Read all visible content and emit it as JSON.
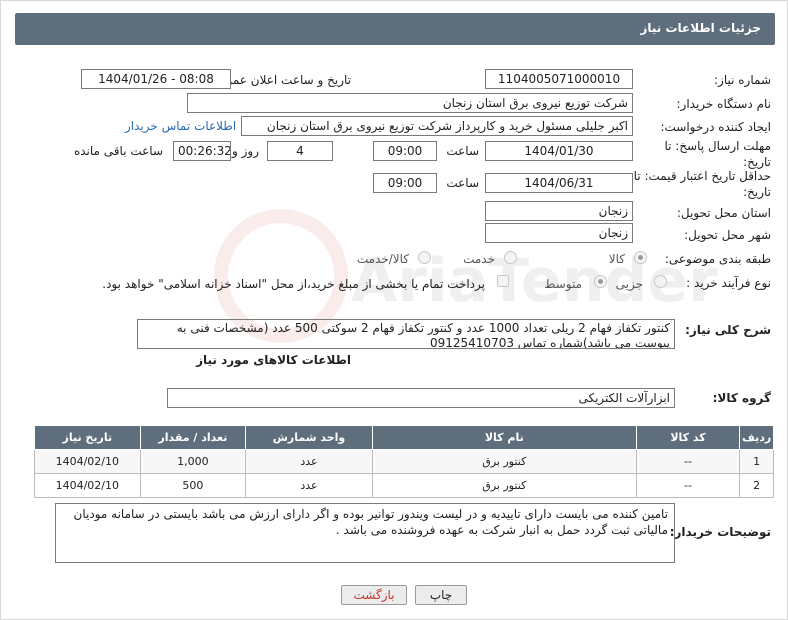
{
  "header": {
    "title": "جزئیات اطلاعات نیاز"
  },
  "fields": {
    "need_number_label": "شماره نیاز:",
    "need_number": "1104005071000010",
    "announce_datetime_label": "تاریخ و ساعت اعلان عمومی:",
    "announce_datetime": "1404/01/26 - 08:08",
    "buyer_org_label": "نام دستگاه خریدار:",
    "buyer_org": "شرکت توزیع نیروی برق استان زنجان",
    "requester_label": "ایجاد کننده درخواست:",
    "requester": "اکبر جلیلی مسئول خرید و کارپرداز شرکت توزیع نیروی برق استان زنجان",
    "buyer_contact_link": "اطلاعات تماس خریدار",
    "deadline_label": "مهلت ارسال پاسخ: تا تاریخ:",
    "deadline_date": "1404/01/30",
    "time_label": "ساعت",
    "deadline_time": "09:00",
    "days_value": "4",
    "days_label": "روز و",
    "remaining_time": "00:26:32",
    "remaining_label": "ساعت باقی مانده",
    "validity_label": "حداقل تاریخ اعتبار قیمت: تا تاریخ:",
    "validity_date": "1404/06/31",
    "validity_time": "09:00",
    "province_label": "استان محل تحویل:",
    "province": "زنجان",
    "city_label": "شهر محل تحویل:",
    "city": "زنجان",
    "category_label": "طبقه بندی موضوعی:",
    "category_options": [
      "کالا",
      "خدمت",
      "کالا/خدمت"
    ],
    "purchase_type_label": "نوع فرآیند خرید :",
    "purchase_options": [
      "جزیی",
      "متوسط"
    ],
    "purchase_note": "پرداخت تمام یا بخشی از مبلغ خرید،از محل \"اسناد خزانه اسلامی\" خواهد بود."
  },
  "description": {
    "label": "شرح کلی نیاز:",
    "text": "کنتور تکفاز فهام 2 ریلی تعداد 1000 عدد و کنتور تکفاز فهام 2 سوکتی 500 عدد (مشخصات فنی به پیوست می باشد)شماره تماس 09125410703"
  },
  "goods_info_title": "اطلاعات کالاهای مورد نیاز",
  "goods_group": {
    "label": "گروه کالا:",
    "value": "ابزارآلات الکتریکی"
  },
  "table": {
    "headers": [
      "ردیف",
      "کد کالا",
      "نام کالا",
      "واحد شمارش",
      "تعداد / مقدار",
      "تاریخ نیاز"
    ],
    "rows": [
      [
        "1",
        "--",
        "کنتور برق",
        "عدد",
        "1,000",
        "1404/02/10"
      ],
      [
        "2",
        "--",
        "کنتور برق",
        "عدد",
        "500",
        "1404/02/10"
      ]
    ]
  },
  "buyer_notes": {
    "label": "توضیحات خریدار:",
    "text": "تامین کننده می بایست دارای تاییدیه و در لیست ویندور توانیر بوده و اگر دارای ارزش می باشد بایستی در سامانه مودیان مالیاتی ثبت گردد حمل به انبار شرکت به عهده فروشنده می باشد ."
  },
  "buttons": {
    "print": "چاپ",
    "back": "بازگشت"
  },
  "colors": {
    "header_bg": "#5f6e7c",
    "link": "#2a6bb0",
    "back_text": "#c0392b"
  }
}
